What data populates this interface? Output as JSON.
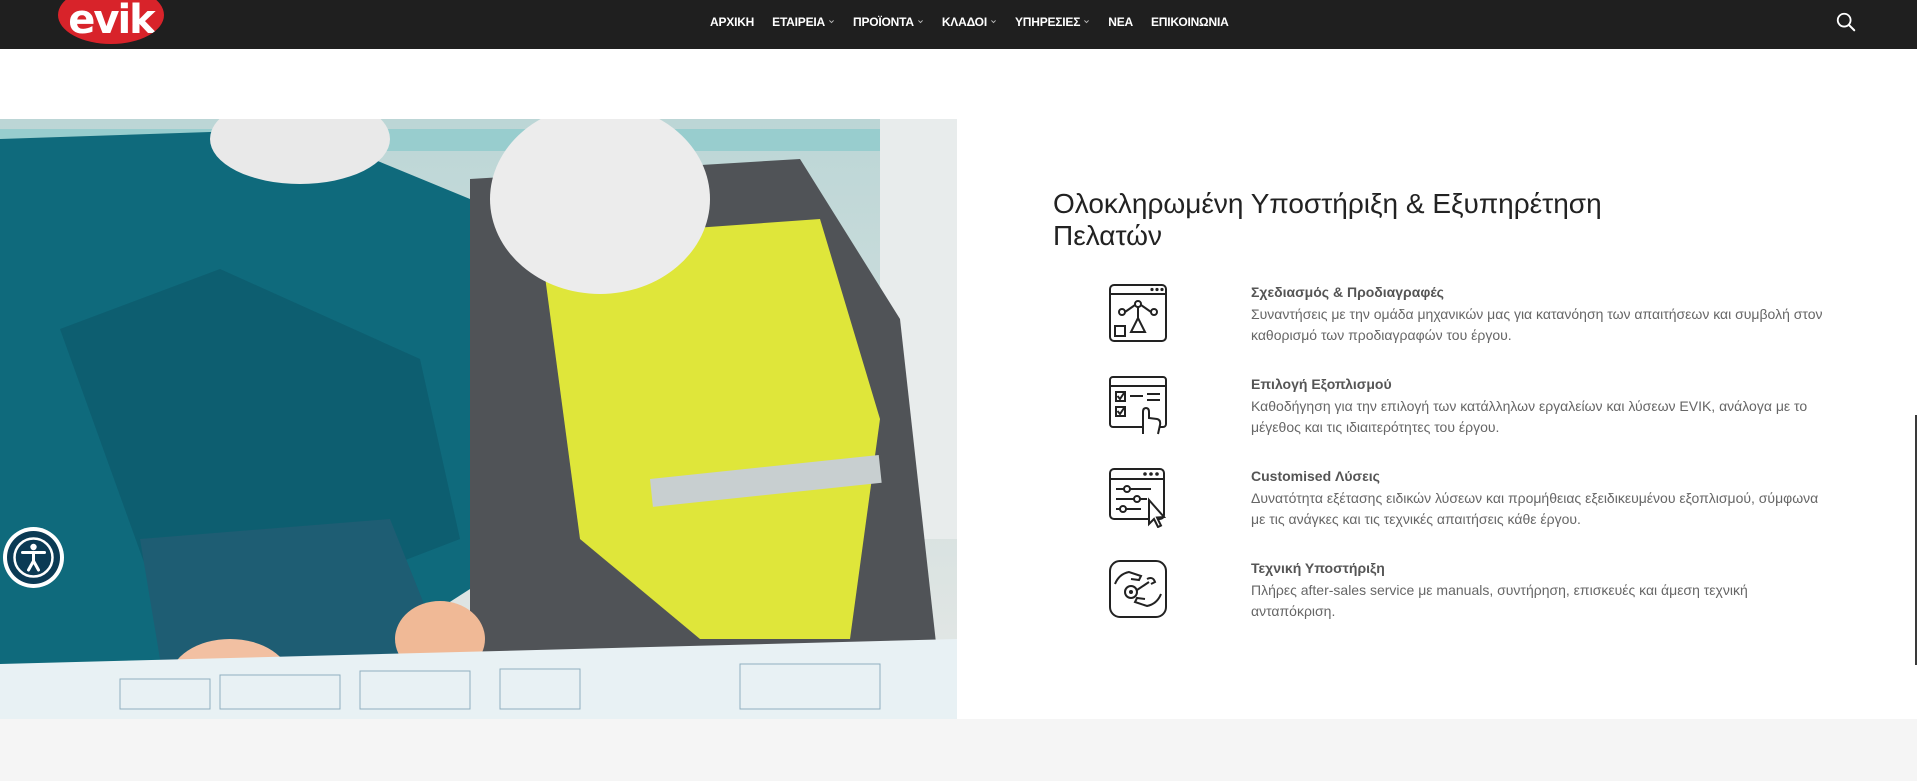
{
  "brand": {
    "logo_text": "evik",
    "color": "#d8232a"
  },
  "nav": {
    "items": [
      {
        "label": "ΑΡΧΙΚΗ",
        "has_dropdown": false
      },
      {
        "label": "ΕΤΑΙΡΕΙΑ",
        "has_dropdown": true
      },
      {
        "label": "ΠΡΟΪΟΝΤΑ",
        "has_dropdown": true
      },
      {
        "label": "ΚΛΑΔΟΙ",
        "has_dropdown": true
      },
      {
        "label": "ΥΠΗΡΕΣΙΕΣ",
        "has_dropdown": true
      },
      {
        "label": "ΝΕΑ",
        "has_dropdown": false
      },
      {
        "label": "ΕΠΙΚΟΙΝΩΝΙΑ",
        "has_dropdown": false
      }
    ],
    "search_icon": "search-icon"
  },
  "section": {
    "title": "Ολοκληρωμένη Υποστήριξη & Εξυπηρέτηση Πελατών",
    "features": [
      {
        "icon": "design-blueprint-icon",
        "title": "Σχεδιασμός & Προδιαγραφές",
        "description": "Συναντήσεις με την ομάδα μηχανικών μας για κατανόηση των απαιτήσεων και συμβολή στον καθορισμό των προδιαγραφών του έργου."
      },
      {
        "icon": "equipment-checklist-icon",
        "title": "Επιλογή Εξοπλισμού",
        "description": "Καθοδήγηση για την επιλογή των κατάλληλων εργαλείων και λύσεων EVIK, ανάλογα με το μέγεθος και τις ιδιαιτερότητες του έργου."
      },
      {
        "icon": "custom-settings-icon",
        "title": "Customised Λύσεις",
        "description": "Δυνατότητα εξέτασης ειδικών λύσεων και προμήθειας εξειδικευμένου εξοπλισμού, σύμφωνα με τις ανάγκες και τις τεχνικές απαιτήσεις κάθε έργου."
      },
      {
        "icon": "technical-support-icon",
        "title": "Τεχνική Υποστήριξη",
        "description": "Πλήρες after-sales service με manuals, συντήρηση, επισκευές και άμεση τεχνική ανταπόκριση."
      }
    ]
  },
  "accessibility": {
    "icon": "accessibility-icon"
  }
}
